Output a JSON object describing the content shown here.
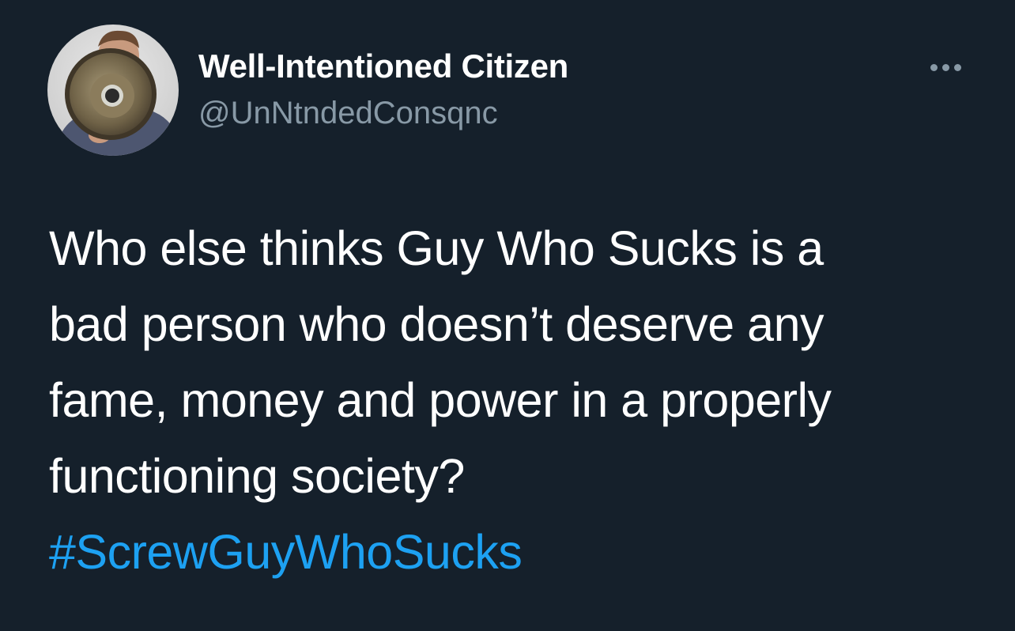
{
  "tweet": {
    "author": {
      "display_name": "Well-Intentioned Citizen",
      "handle": "@UnNtndedConsqnc",
      "avatar_icon": "person-with-megaphone-avatar"
    },
    "more_icon": "more-options-icon",
    "text_lines": [
      "Who else thinks Guy Who Sucks is a",
      "bad person who doesn’t deserve any",
      "fame, money and power in a properly",
      "functioning society?"
    ],
    "hashtag": "#ScrewGuyWhoSucks"
  },
  "colors": {
    "background": "#15202b",
    "primary_text": "#ffffff",
    "secondary_text": "#8899a6",
    "link": "#1da1f2"
  }
}
